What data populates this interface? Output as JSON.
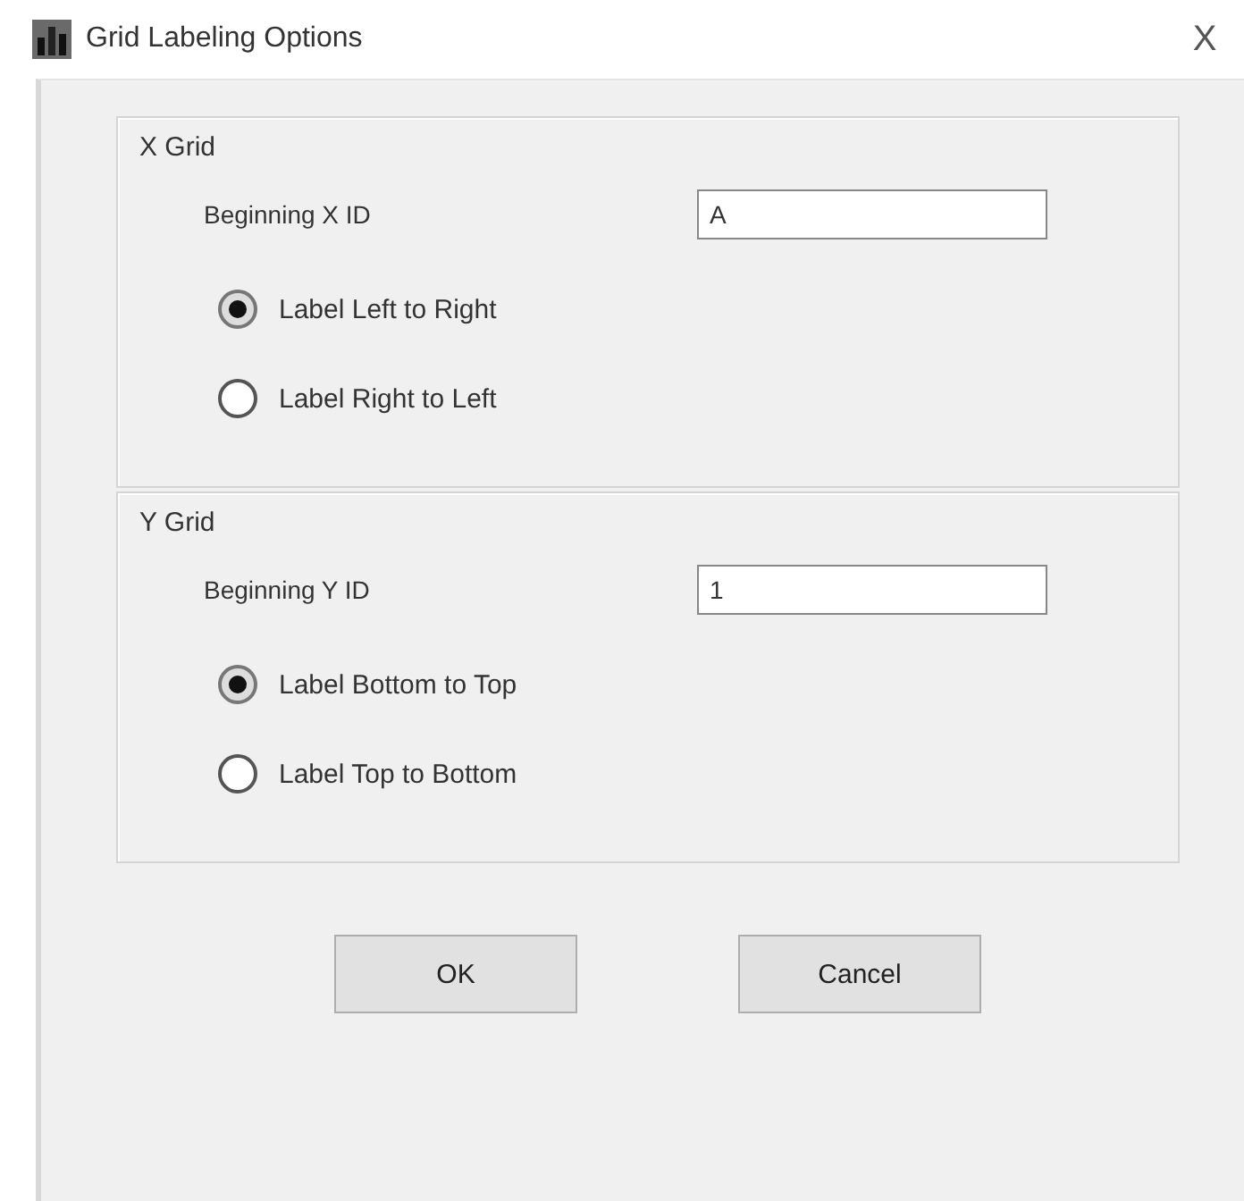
{
  "window": {
    "title": "Grid Labeling Options",
    "close": "X"
  },
  "groups": [
    {
      "title": "X Grid",
      "field_label": "Beginning X ID",
      "value": "A",
      "options": [
        {
          "label": "Label Left to Right",
          "selected": true
        },
        {
          "label": "Label Right to Left",
          "selected": false
        }
      ]
    },
    {
      "title": "Y Grid",
      "field_label": "Beginning Y ID",
      "value": "1",
      "options": [
        {
          "label": "Label Bottom to Top",
          "selected": true
        },
        {
          "label": "Label Top to Bottom",
          "selected": false
        }
      ]
    }
  ],
  "buttons": [
    "OK",
    "Cancel"
  ]
}
